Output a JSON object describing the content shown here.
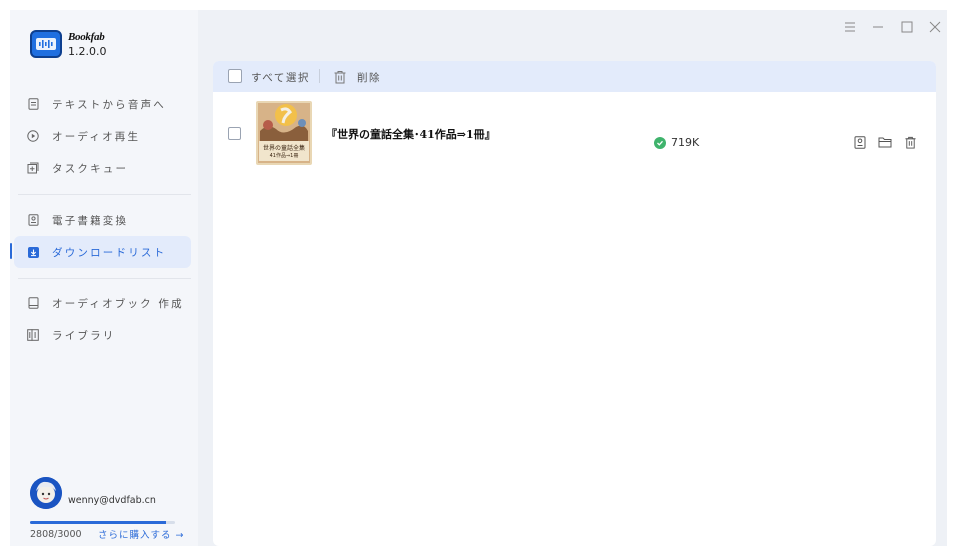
{
  "app": {
    "name": "Bookfab",
    "version": "1.2.0.0"
  },
  "sidebar": {
    "items": [
      {
        "label": "テキストから音声へ",
        "icon": "document-icon"
      },
      {
        "label": "オーディオ再生",
        "icon": "play-circle-icon"
      },
      {
        "label": "タスクキュー",
        "icon": "queue-icon"
      },
      {
        "label": "電子書籍変換",
        "icon": "ebook-icon"
      },
      {
        "label": "ダウンロードリスト",
        "icon": "download-icon",
        "active": true
      },
      {
        "label": "オーディオブック 作成",
        "icon": "book-icon"
      },
      {
        "label": "ライブラリ",
        "icon": "library-icon"
      }
    ]
  },
  "account": {
    "email": "wenny@dvdfab.cn",
    "quota_text": "2808/3000",
    "quota_fraction": 0.936,
    "buy_label": "さらに購入する →"
  },
  "toolbar": {
    "select_all_label": "すべて選択",
    "delete_label": "削除"
  },
  "downloads": [
    {
      "title": "『世界の童話全集･41作品⇒1冊』",
      "cover_line1": "世界の童話全集",
      "cover_line2": "41作品⇒1冊",
      "status": "completed",
      "size": "719K"
    }
  ],
  "colors": {
    "accent": "#2a6ad8",
    "success": "#3fb36c",
    "active_bg": "#e3ebfb"
  }
}
